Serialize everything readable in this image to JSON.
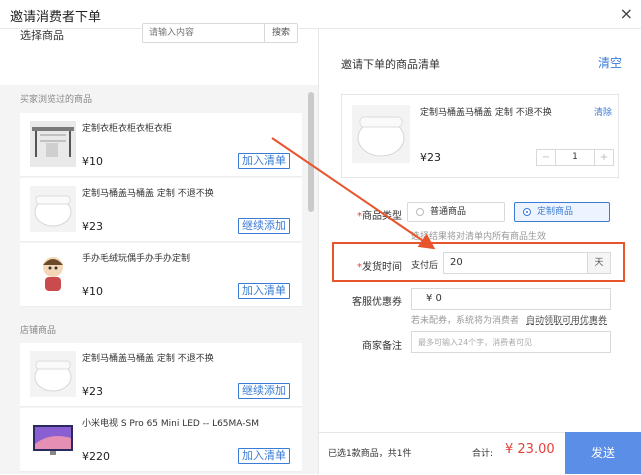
{
  "window": {
    "title": "邀请消费者下单",
    "close": "×"
  },
  "left": {
    "select_label": "选择商品",
    "search_placeholder": "请输入内容",
    "search_button": "搜索",
    "recent_label": "买家浏览过的商品",
    "store_label": "店铺商品",
    "recent_products": [
      {
        "name": "定制衣柜衣柜衣柜衣柜",
        "price": "¥10",
        "action": "加入清单"
      },
      {
        "name": "定制马桶盖马桶盖 定制 不退不换",
        "price": "¥23",
        "action": "继续添加"
      },
      {
        "name": "手办毛绒玩偶手办手办定制",
        "price": "¥10",
        "action": "加入清单"
      }
    ],
    "store_products": [
      {
        "name": "定制马桶盖马桶盖 定制 不退不换",
        "price": "¥23",
        "action": "继续添加"
      },
      {
        "name": "小米电视 S Pro 65 Mini LED -- L65MA-SM",
        "price": "¥220",
        "action": "加入清单"
      }
    ]
  },
  "right": {
    "title": "邀请下单的商品清单",
    "clear": "清空",
    "selected": {
      "name": "定制马桶盖马桶盖 定制 不退不换",
      "remove": "清除",
      "price": "¥23",
      "minus": "−",
      "qty": "1",
      "plus": "+"
    },
    "type_label": "商品类型",
    "type_options": [
      "普通商品",
      "定制商品"
    ],
    "type_hint": "选择结果将对清单内所有商品生效",
    "delivery_label": "发货时间",
    "delivery_prefix": "支付后",
    "delivery_value": "20",
    "delivery_unit": "天",
    "coupon_label": "客服优惠券",
    "coupon_value": "¥  0",
    "coupon_hint": "若未配券，系统将为消费者",
    "coupon_link": "自动领取可用优惠券",
    "note_label": "商家备注",
    "note_placeholder": "最多可输入24个字，消费者可见",
    "asterisk": "*"
  },
  "footer": {
    "count_text": "已选1款商品，共1件",
    "total_label": "合计:",
    "total_value": "¥ 23.00",
    "send": "发送"
  },
  "colors": {
    "accent": "#3a7bd5",
    "price_red": "#e0433a",
    "annotation": "#e8542b",
    "send_bg": "#5b8ee6"
  }
}
